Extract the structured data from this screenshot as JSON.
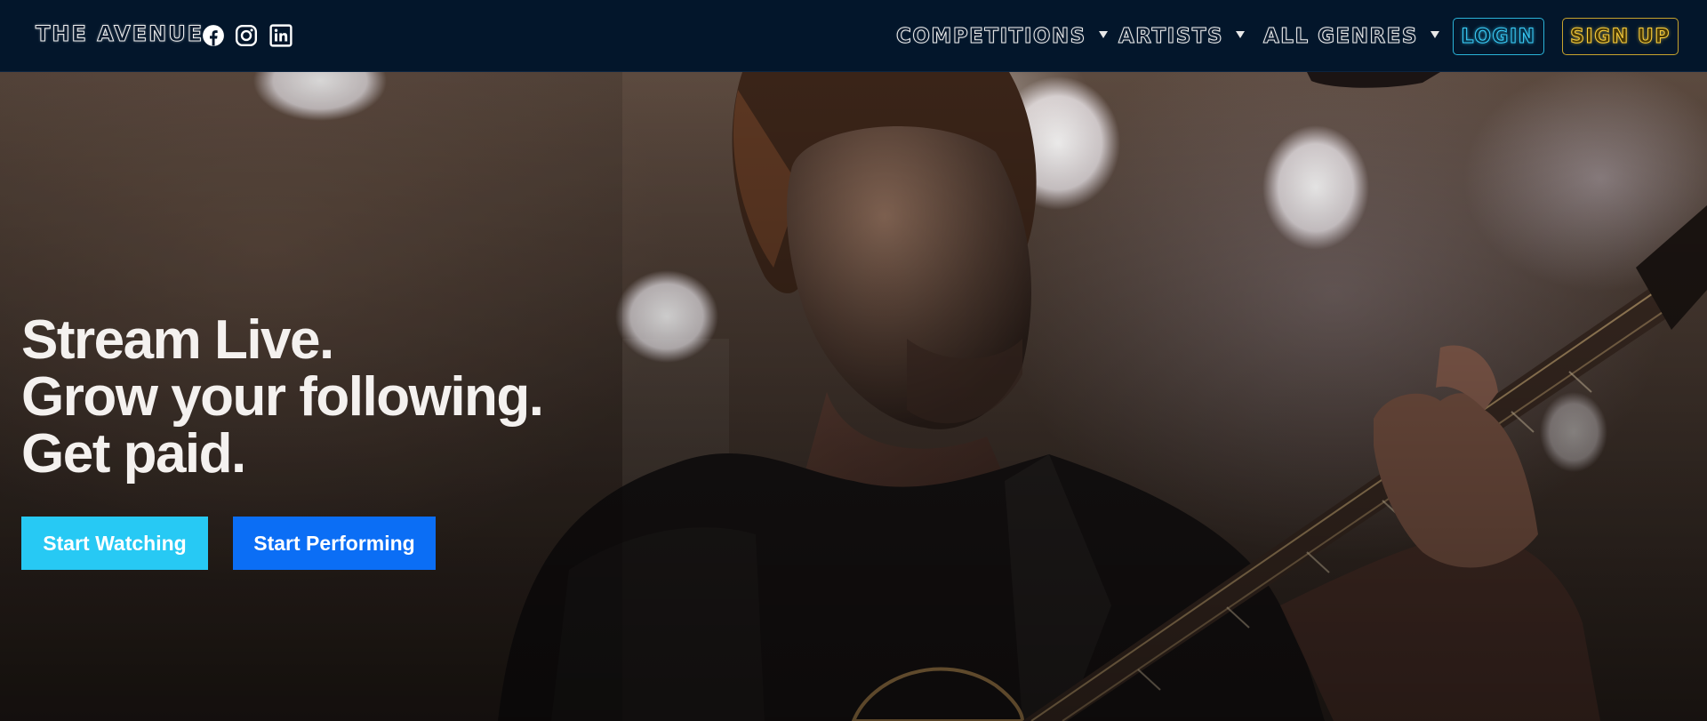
{
  "brand": {
    "name": "THE AVENUE"
  },
  "social": [
    {
      "icon": "facebook-icon"
    },
    {
      "icon": "instagram-icon"
    },
    {
      "icon": "linkedin-icon"
    }
  ],
  "nav": {
    "items": [
      {
        "label": "COMPETITIONS"
      },
      {
        "label": "ARTISTS"
      },
      {
        "label": "ALL GENRES"
      }
    ],
    "login_label": "LOGIN",
    "signup_label": "SIGN UP"
  },
  "hero": {
    "headline": [
      "Stream Live.",
      "Grow your following.",
      "Get paid."
    ],
    "cta_watch": "Start Watching",
    "cta_perform": "Start Performing"
  },
  "colors": {
    "navbar_bg": "#03162b",
    "login_accent": "#3cd3ff",
    "signup_accent": "#ffd23c",
    "cta_watch_bg": "#27c9f4",
    "cta_perform_bg": "#0b6ef5"
  }
}
